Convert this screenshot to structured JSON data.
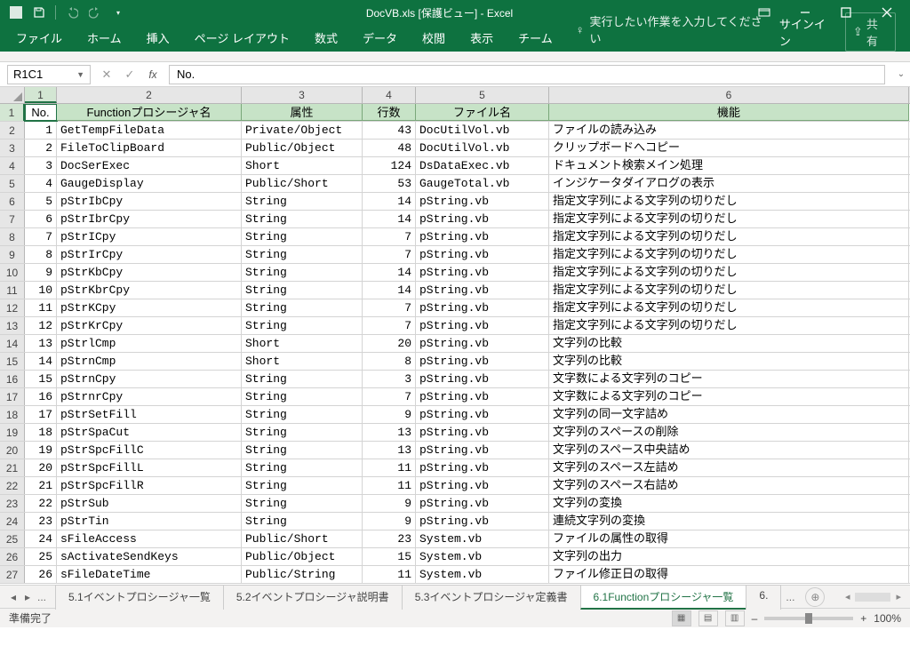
{
  "title_bar": {
    "title": "DocVB.xls  [保護ビュー] - Excel"
  },
  "ribbon": {
    "tabs": [
      "ファイル",
      "ホーム",
      "挿入",
      "ページ レイアウト",
      "数式",
      "データ",
      "校閲",
      "表示",
      "チーム"
    ],
    "tell_me": "実行したい作業を入力してください",
    "signin": "サインイン",
    "share": "共有"
  },
  "name_box": "R1C1",
  "formula": "No.",
  "col_headers": [
    "1",
    "2",
    "3",
    "4",
    "5",
    "6"
  ],
  "table_headers": [
    "No.",
    "Functionプロシージャ名",
    "属性",
    "行数",
    "ファイル名",
    "機能"
  ],
  "rows": [
    {
      "n": "2",
      "d": [
        "1",
        "GetTempFileData",
        "Private/Object",
        "43",
        "DocUtilVol.vb",
        "ファイルの読み込み"
      ]
    },
    {
      "n": "3",
      "d": [
        "2",
        "FileToClipBoard",
        "Public/Object",
        "48",
        "DocUtilVol.vb",
        "クリップボードへコピー"
      ]
    },
    {
      "n": "4",
      "d": [
        "3",
        "DocSerExec",
        "Short",
        "124",
        "DsDataExec.vb",
        "ドキュメント検索メイン処理"
      ]
    },
    {
      "n": "5",
      "d": [
        "4",
        "GaugeDisplay",
        "Public/Short",
        "53",
        "GaugeTotal.vb",
        "インジケータダイアログの表示"
      ]
    },
    {
      "n": "6",
      "d": [
        "5",
        "pStrIbCpy",
        "String",
        "14",
        "pString.vb",
        "指定文字列による文字列の切りだし"
      ]
    },
    {
      "n": "7",
      "d": [
        "6",
        "pStrIbrCpy",
        "String",
        "14",
        "pString.vb",
        "指定文字列による文字列の切りだし"
      ]
    },
    {
      "n": "8",
      "d": [
        "7",
        "pStrICpy",
        "String",
        "7",
        "pString.vb",
        "指定文字列による文字列の切りだし"
      ]
    },
    {
      "n": "9",
      "d": [
        "8",
        "pStrIrCpy",
        "String",
        "7",
        "pString.vb",
        "指定文字列による文字列の切りだし"
      ]
    },
    {
      "n": "10",
      "d": [
        "9",
        "pStrKbCpy",
        "String",
        "14",
        "pString.vb",
        "指定文字列による文字列の切りだし"
      ]
    },
    {
      "n": "11",
      "d": [
        "10",
        "pStrKbrCpy",
        "String",
        "14",
        "pString.vb",
        "指定文字列による文字列の切りだし"
      ]
    },
    {
      "n": "12",
      "d": [
        "11",
        "pStrKCpy",
        "String",
        "7",
        "pString.vb",
        "指定文字列による文字列の切りだし"
      ]
    },
    {
      "n": "13",
      "d": [
        "12",
        "pStrKrCpy",
        "String",
        "7",
        "pString.vb",
        "指定文字列による文字列の切りだし"
      ]
    },
    {
      "n": "14",
      "d": [
        "13",
        "pStrlCmp",
        "Short",
        "20",
        "pString.vb",
        "文字列の比較"
      ]
    },
    {
      "n": "15",
      "d": [
        "14",
        "pStrnCmp",
        "Short",
        "8",
        "pString.vb",
        "文字列の比較"
      ]
    },
    {
      "n": "16",
      "d": [
        "15",
        "pStrnCpy",
        "String",
        "3",
        "pString.vb",
        "文字数による文字列のコピー"
      ]
    },
    {
      "n": "17",
      "d": [
        "16",
        "pStrnrCpy",
        "String",
        "7",
        "pString.vb",
        "文字数による文字列のコピー"
      ]
    },
    {
      "n": "18",
      "d": [
        "17",
        "pStrSetFill",
        "String",
        "9",
        "pString.vb",
        "文字列の同一文字詰め"
      ]
    },
    {
      "n": "19",
      "d": [
        "18",
        "pStrSpaCut",
        "String",
        "13",
        "pString.vb",
        "文字列のスペースの削除"
      ]
    },
    {
      "n": "20",
      "d": [
        "19",
        "pStrSpcFillC",
        "String",
        "13",
        "pString.vb",
        "文字列のスペース中央詰め"
      ]
    },
    {
      "n": "21",
      "d": [
        "20",
        "pStrSpcFillL",
        "String",
        "11",
        "pString.vb",
        "文字列のスペース左詰め"
      ]
    },
    {
      "n": "22",
      "d": [
        "21",
        "pStrSpcFillR",
        "String",
        "11",
        "pString.vb",
        "文字列のスペース右詰め"
      ]
    },
    {
      "n": "23",
      "d": [
        "22",
        "pStrSub",
        "String",
        "9",
        "pString.vb",
        "文字列の変換"
      ]
    },
    {
      "n": "24",
      "d": [
        "23",
        "pStrTin",
        "String",
        "9",
        "pString.vb",
        "連続文字列の変換"
      ]
    },
    {
      "n": "25",
      "d": [
        "24",
        "sFileAccess",
        "Public/Short",
        "23",
        "System.vb",
        "ファイルの属性の取得"
      ]
    },
    {
      "n": "26",
      "d": [
        "25",
        "sActivateSendKeys",
        "Public/Object",
        "15",
        "System.vb",
        "文字列の出力"
      ]
    },
    {
      "n": "27",
      "d": [
        "26",
        "sFileDateTime",
        "Public/String",
        "11",
        "System.vb",
        "ファイル修正日の取得"
      ]
    }
  ],
  "sheet_tabs": {
    "overflow": "...",
    "tabs": [
      "5.1イベントプロシージャ一覧",
      "5.2イベントプロシージャ説明書",
      "5.3イベントプロシージャ定義書",
      "6.1Functionプロシージャ一覧",
      "6."
    ],
    "active_index": 3,
    "more": "..."
  },
  "status": {
    "ready": "準備完了",
    "zoom": "100%"
  }
}
